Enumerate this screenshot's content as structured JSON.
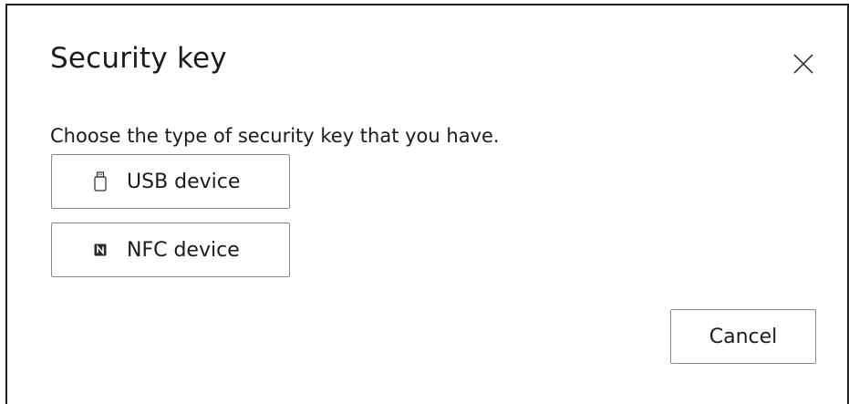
{
  "dialog": {
    "title": "Security key",
    "close_icon": "close-icon",
    "prompt": "Choose the type of security key that you have.",
    "options": [
      {
        "label": "USB device",
        "icon": "usb-icon"
      },
      {
        "label": "NFC device",
        "icon": "nfc-icon"
      }
    ],
    "cancel_label": "Cancel"
  }
}
